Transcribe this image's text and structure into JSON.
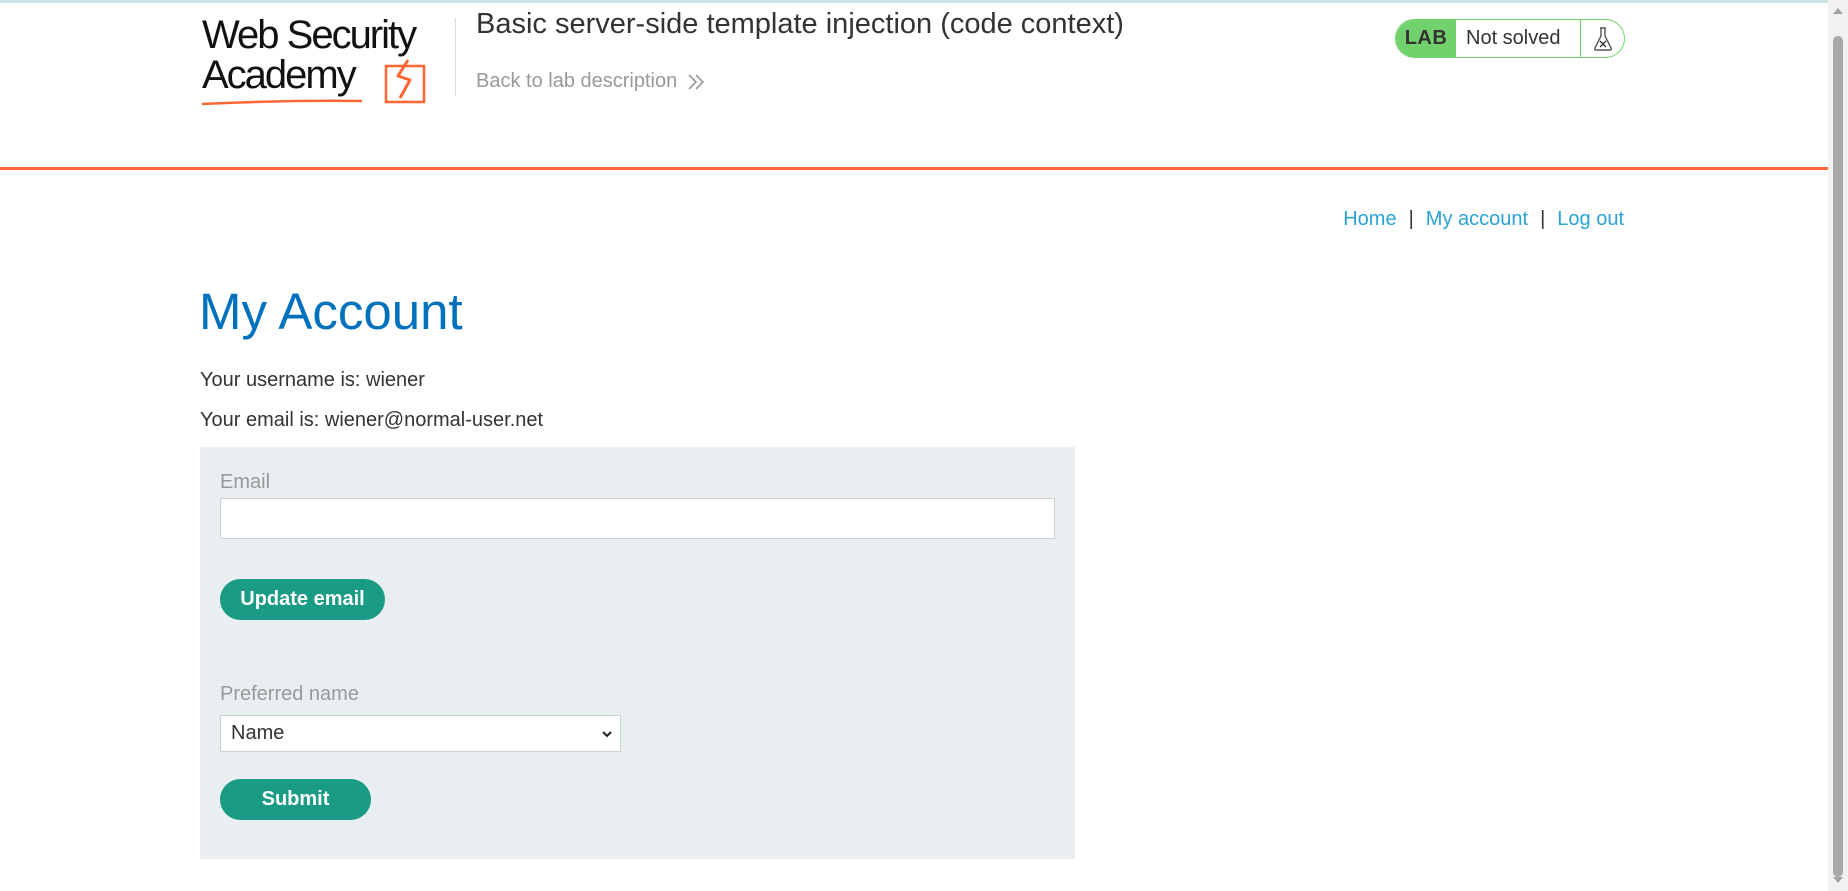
{
  "header": {
    "logo_text": [
      "Web Security",
      "Academy"
    ],
    "lab_title": "Basic server-side template injection (code context)",
    "back_link": "Back to lab description",
    "status": {
      "badge": "LAB",
      "text": "Not solved"
    }
  },
  "nav": {
    "home": "Home",
    "separator": "|",
    "my_account": "My account",
    "log_out": "Log out"
  },
  "main": {
    "title": "My Account",
    "username_line": "Your username is: wiener",
    "email_line": "Your email is: wiener@normal-user.net",
    "form": {
      "email_label": "Email",
      "email_value": "",
      "update_button": "Update email",
      "preferred_name_label": "Preferred name",
      "preferred_name_selected": "Name",
      "submit_button": "Submit"
    }
  },
  "colors": {
    "accent_orange": "#ff6633",
    "title_blue": "#0071bc",
    "link_blue": "#29a3d6",
    "button_green": "#1a9b85",
    "lab_green": "#70d16d",
    "panel_bg": "#e9eef1"
  },
  "icons": {
    "back": "double-chevron-right-icon",
    "status": "flask-icon",
    "select": "chevron-down-icon"
  }
}
